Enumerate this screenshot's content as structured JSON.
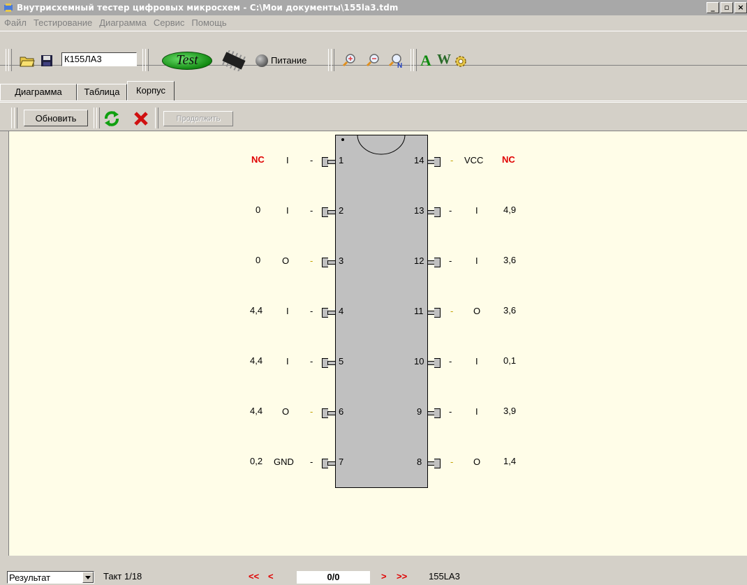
{
  "window": {
    "title": "Внутрисхемный тестер цифровых микросхем - C:\\Мои документы\\155la3.tdm",
    "buttons": [
      "_",
      "▫",
      "×"
    ]
  },
  "menu": [
    "Файл",
    "Тестирование",
    "Диаграмма",
    "Сервис",
    "Помощь"
  ],
  "toolbar": {
    "chip_value": "К155ЛА3",
    "test_label": "Test",
    "power_label": "Питание",
    "font_a": "A",
    "font_w": "W"
  },
  "tabs": [
    "Диаграмма",
    "Таблица",
    "Корпус"
  ],
  "subtoolbar": {
    "refresh_label": "Обновить",
    "continue_label": "Продолжить"
  },
  "pins_left": [
    {
      "num": "1",
      "label": "I",
      "value": "NC",
      "nc": true
    },
    {
      "num": "2",
      "label": "I",
      "value": "0",
      "nc": false
    },
    {
      "num": "3",
      "label": "O",
      "value": "0",
      "nc": false
    },
    {
      "num": "4",
      "label": "I",
      "value": "4,4",
      "nc": false
    },
    {
      "num": "5",
      "label": "I",
      "value": "4,4",
      "nc": false
    },
    {
      "num": "6",
      "label": "O",
      "value": "4,4",
      "nc": false
    },
    {
      "num": "7",
      "label": "GND",
      "value": "0,2",
      "nc": false
    }
  ],
  "pins_right": [
    {
      "num": "14",
      "label": "VCC",
      "value": "NC",
      "nc": true
    },
    {
      "num": "13",
      "label": "I",
      "value": "4,9",
      "nc": false
    },
    {
      "num": "12",
      "label": "I",
      "value": "3,6",
      "nc": false
    },
    {
      "num": "11",
      "label": "O",
      "value": "3,6",
      "nc": false
    },
    {
      "num": "10",
      "label": "I",
      "value": "0,1",
      "nc": false
    },
    {
      "num": "9",
      "label": "I",
      "value": "3,9",
      "nc": false
    },
    {
      "num": "8",
      "label": "O",
      "value": "1,4",
      "nc": false
    }
  ],
  "status": {
    "mode": "Результат",
    "tact": "Такт 1/18",
    "first": "<<",
    "prev": "<",
    "position": "0/0",
    "next": ">",
    "last": ">>",
    "chip": "155LA3"
  }
}
